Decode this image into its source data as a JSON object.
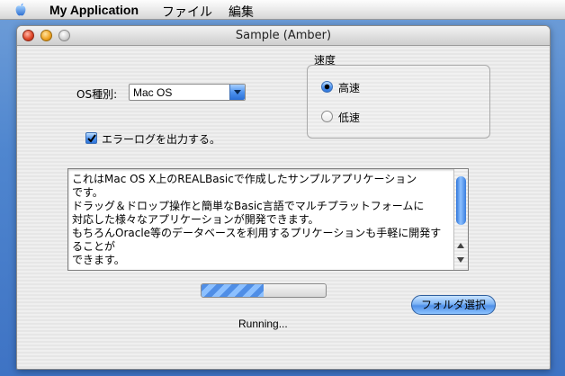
{
  "menubar": {
    "apple_icon": "apple-icon",
    "app_name": "My Application",
    "items": [
      "ファイル",
      "編集"
    ]
  },
  "window": {
    "title": "Sample (Amber)"
  },
  "form": {
    "os_label": "OS種別:",
    "os_select_value": "Mac OS",
    "checkbox_label": "エラーログを出力する。",
    "checkbox_checked": true,
    "speed_group_title": "速度",
    "radios": [
      {
        "label": "高速",
        "selected": true
      },
      {
        "label": "低速",
        "selected": false
      }
    ],
    "textarea_text": "これはMac OS X上のREALBasicで作成したサンプルアプリケーション\nです。\nドラッグ＆ドロップ操作と簡単なBasic言語でマルチプラットフォームに\n対応した様々なアプリケーションが開発できます。\nもちろんOracle等のデータベースを利用するプリケーションも手軽に開発することが\nできます。",
    "progress_fraction": 0.5,
    "status_text": "Running...",
    "folder_button_label": "フォルダ選択"
  },
  "colors": {
    "desktop": "#4f86cf",
    "aqua_blue": "#4e93ef",
    "close": "#e04a2c",
    "minimize": "#f0a628"
  }
}
